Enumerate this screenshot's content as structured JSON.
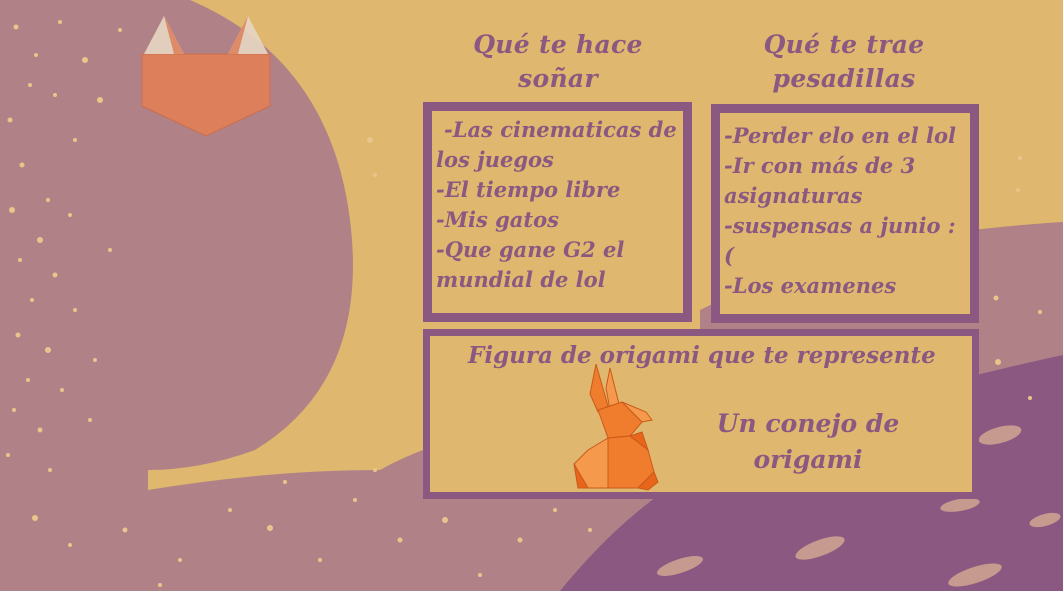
{
  "dream_section": {
    "title": "Qué te hace soñar",
    "items": [
      "-Las cinematicas de los juegos",
      "-El tiempo libre",
      "-Mis gatos",
      "-Que gane G2 el mundial de lol"
    ]
  },
  "nightmare_section": {
    "title": "Qué te trae pesadillas",
    "items": [
      "-Perder elo en el lol",
      "-Ir con más de 3 asignaturas",
      "-suspensas a junio :(",
      "-Los examenes"
    ]
  },
  "origami_section": {
    "title": "Figura de origami que te represente",
    "answer": "Un conejo de origami",
    "figure_icon": "origami-rabbit-icon"
  },
  "logo": {
    "icon": "fox-head-icon"
  },
  "colors": {
    "background_sand": "#dfb76e",
    "accent_purple": "#8a5880",
    "moon_mauve": "#b08287",
    "origami_orange": "#f07c2e",
    "fox_orange": "#dd7f5a"
  }
}
